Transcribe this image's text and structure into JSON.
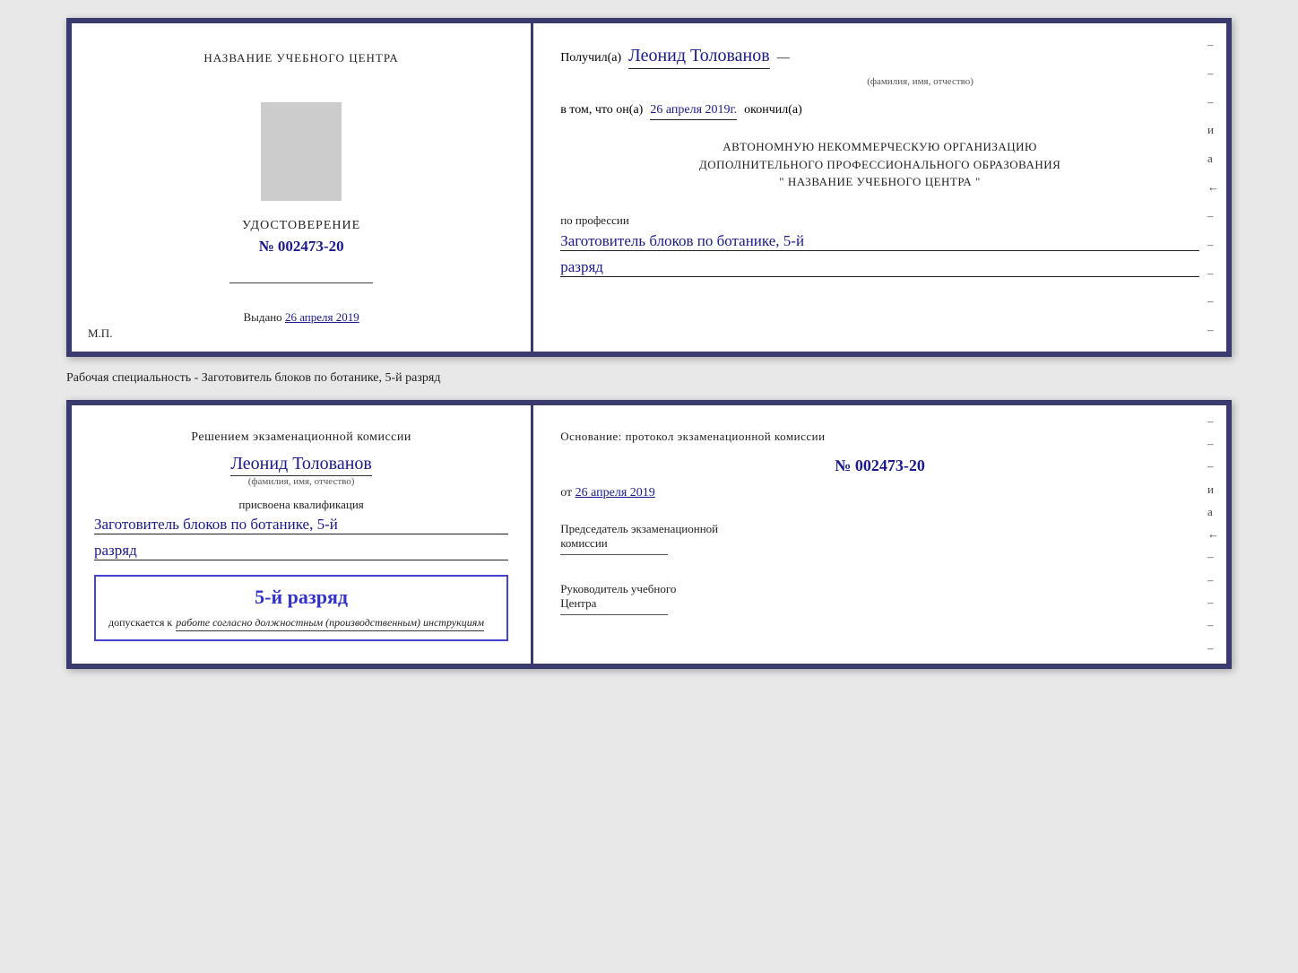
{
  "top_card": {
    "left": {
      "training_center_label": "НАЗВАНИЕ УЧЕБНОГО ЦЕНТРА",
      "cert_title": "УДОСТОВЕРЕНИЕ",
      "cert_number_prefix": "№",
      "cert_number": "002473-20",
      "issued_label": "Выдано",
      "issued_date": "26 апреля 2019",
      "mp_label": "М.П."
    },
    "right": {
      "recipient_prefix": "Получил(а)",
      "recipient_name": "Леонид Толованов",
      "fio_label": "(фамилия, имя, отчество)",
      "cert_line1": "в том, что он(а)",
      "cert_date": "26 апреля 2019г.",
      "cert_finished": "окончил(а)",
      "org_line1": "АВТОНОМНУЮ НЕКОММЕРЧЕСКУЮ ОРГАНИЗАЦИЮ",
      "org_line2": "ДОПОЛНИТЕЛЬНОГО ПРОФЕССИОНАЛЬНОГО ОБРАЗОВАНИЯ",
      "org_line3": "\" НАЗВАНИЕ УЧЕБНОГО ЦЕНТРА \"",
      "profession_label": "по профессии",
      "profession_value": "Заготовитель блоков по ботанике, 5-й",
      "rank_value": "разряд"
    }
  },
  "annotation": "Рабочая специальность - Заготовитель блоков по ботанике, 5-й разряд",
  "bottom_card": {
    "left": {
      "decision_text": "Решением экзаменационной комиссии",
      "person_name": "Леонид Толованов",
      "fio_label": "(фамилия, имя, отчество)",
      "qualification_label": "присвоена квалификация",
      "qualification_value": "Заготовитель блоков по ботанике, 5-й",
      "rank_value": "разряд",
      "stamp_rank": "5-й разряд",
      "stamp_admit_prefix": "допускается к",
      "stamp_admit_italic": "работе согласно должностным (производственным) инструкциям"
    },
    "right": {
      "basis_label": "Основание: протокол экзаменационной комиссии",
      "protocol_prefix": "№",
      "protocol_number": "002473-20",
      "date_prefix": "от",
      "date_value": "26 апреля 2019",
      "chairman_label1": "Председатель экзаменационной",
      "chairman_label2": "комиссии",
      "director_label1": "Руководитель учебного",
      "director_label2": "Центра"
    }
  },
  "dashes": [
    "-",
    "-",
    "-",
    "-",
    "и",
    "а",
    "←",
    "-",
    "-",
    "-",
    "-",
    "-"
  ]
}
